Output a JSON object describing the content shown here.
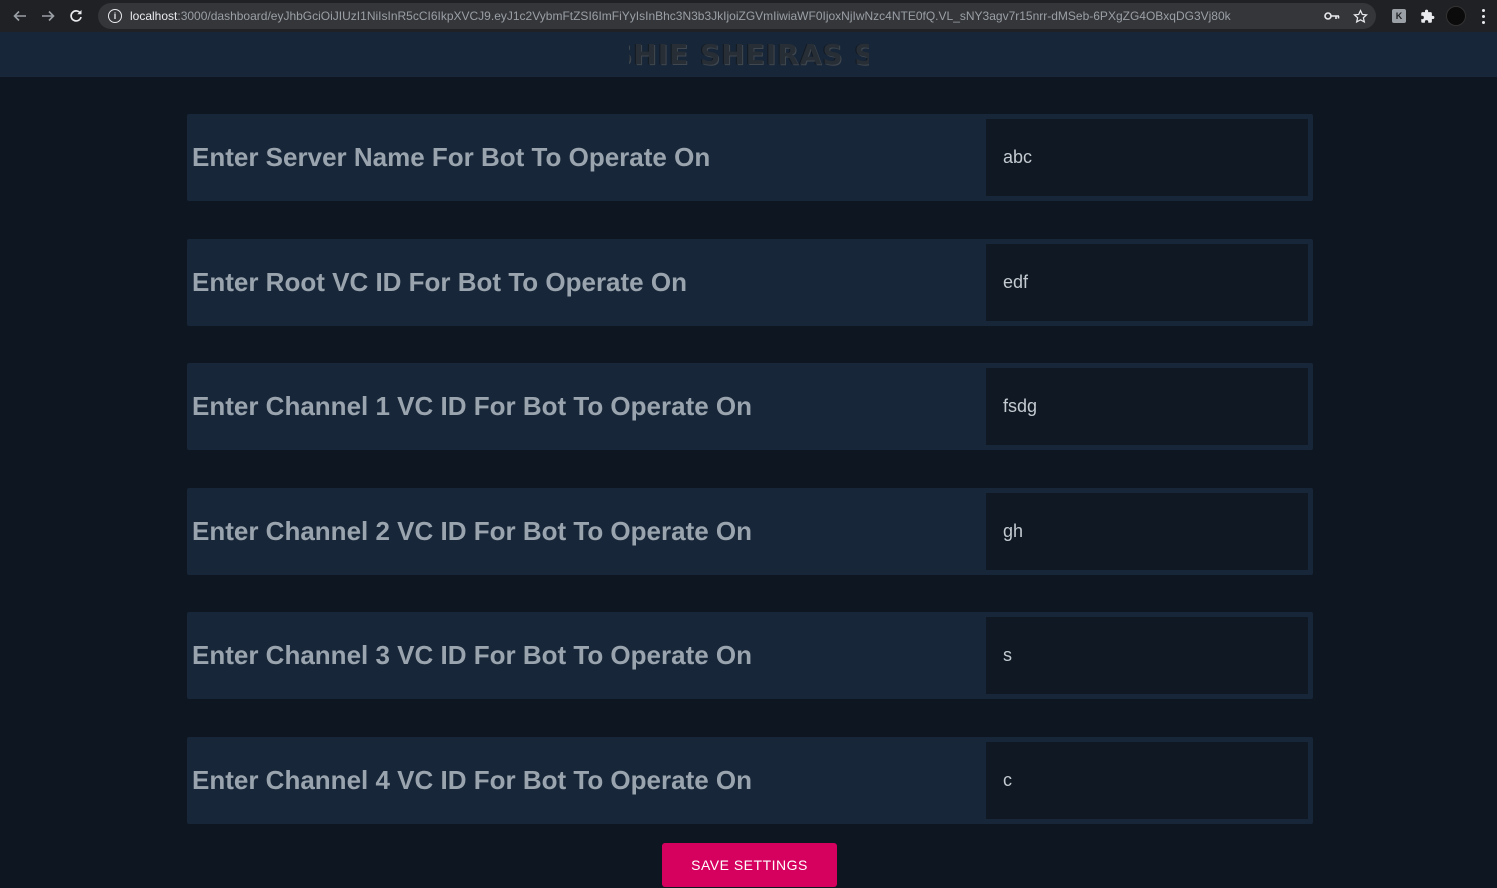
{
  "browser": {
    "url_host": "localhost",
    "url_path": ":3000/dashboard/eyJhbGciOiJIUzI1NiIsInR5cCI6IkpXVCJ9.eyJ1c2VybmFtZSI6ImFiYyIsInBhc3N3b3JkIjoiZGVmIiwiaWF0IjoxNjIwNzc4NTE0fQ.VL_sNY3agv7r15nrr-dMSeb-6PXgZG4OBxqDG3Vj80k",
    "icons": [
      "back-arrow-icon",
      "forward-arrow-icon",
      "reload-icon",
      "info-icon",
      "key-icon",
      "star-icon",
      "extension-icon",
      "puzzle-icon",
      "profile-avatar",
      "kebab-menu-icon"
    ],
    "extension_badge": "K"
  },
  "header": {
    "logo_text": "K SHIE SHEIRAS SEK"
  },
  "settings": [
    {
      "label": "Enter Server Name For Bot To Operate On",
      "value": "abc"
    },
    {
      "label": "Enter Root VC ID For Bot To Operate On",
      "value": "edf"
    },
    {
      "label": "Enter Channel 1 VC ID For Bot To Operate On",
      "value": "fsdg"
    },
    {
      "label": "Enter Channel 2 VC ID For Bot To Operate On",
      "value": "gh"
    },
    {
      "label": "Enter Channel 3 VC ID For Bot To Operate On",
      "value": "s"
    },
    {
      "label": "Enter Channel 4 VC ID For Bot To Operate On",
      "value": "c"
    }
  ],
  "save_button": {
    "label": "SAVE SETTINGS"
  },
  "colors": {
    "page_background": "#0e1621",
    "panel_background": "#172638",
    "input_background": "#0f1823",
    "label_text": "#9aa4ae",
    "save_button": "#d6005f"
  }
}
